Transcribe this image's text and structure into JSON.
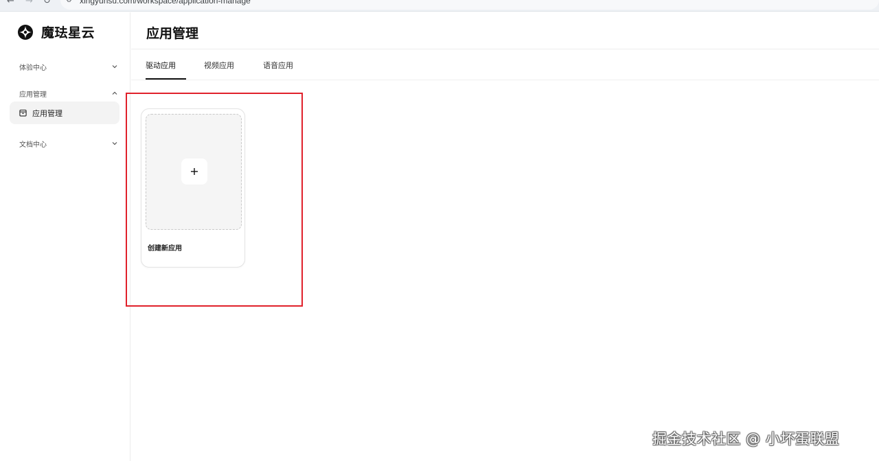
{
  "browser": {
    "back_icon": "arrow-left-icon",
    "forward_icon": "arrow-right-icon",
    "reload_icon": "reload-icon",
    "site_icon": "site-info-icon",
    "url": "xingyunsu.com/workspace/application-manage"
  },
  "brand": {
    "name": "魔珐星云",
    "logo_icon": "brand-logo-icon"
  },
  "sidebar": {
    "groups": [
      {
        "label": "体验中心",
        "expanded": false,
        "chevron_icon": "chevron-down-icon"
      },
      {
        "label": "应用管理",
        "expanded": true,
        "chevron_icon": "chevron-up-icon",
        "items": [
          {
            "label": "应用管理",
            "icon": "app-box-icon",
            "selected": true
          }
        ]
      },
      {
        "label": "文档中心",
        "expanded": false,
        "chevron_icon": "chevron-down-icon"
      }
    ]
  },
  "page": {
    "title": "应用管理",
    "tabs": [
      {
        "label": "驱动应用",
        "active": true
      },
      {
        "label": "视频应用",
        "active": false
      },
      {
        "label": "语音应用",
        "active": false
      }
    ],
    "create_card": {
      "label": "创建新应用",
      "icon": "plus-icon"
    }
  },
  "annotation": {
    "color": "#e0202a"
  },
  "watermark": "掘金技术社区 @ 小坏蛋联盟"
}
